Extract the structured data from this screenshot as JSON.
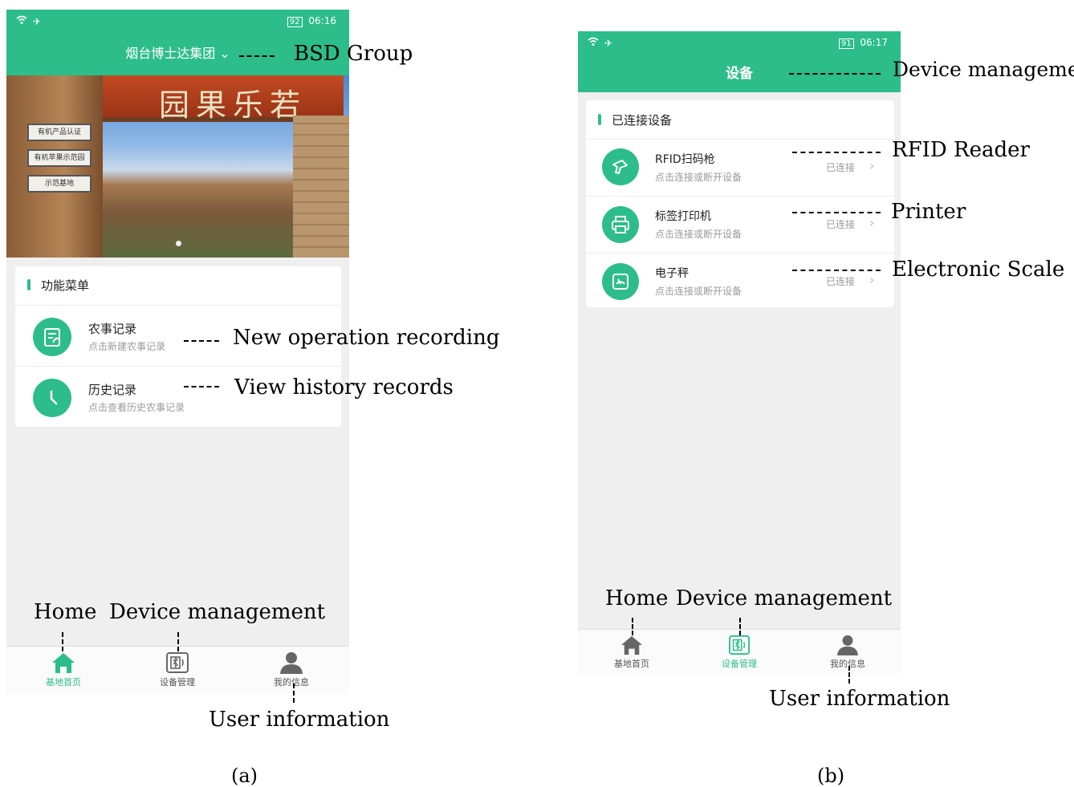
{
  "panel_a": {
    "status_time": "06:16",
    "battery": "92",
    "header_title": "烟台博士达集团",
    "section_title": "功能菜单",
    "items": [
      {
        "title": "农事记录",
        "subtitle": "点击新建农事记录"
      },
      {
        "title": "历史记录",
        "subtitle": "点击查看历史农事记录"
      }
    ],
    "tabs": [
      "基地首页",
      "设备管理",
      "我的信息"
    ]
  },
  "panel_b": {
    "status_time": "06:17",
    "battery": "91",
    "header_title": "设备",
    "section_title": "已连接设备",
    "devices": [
      {
        "title": "RFID扫码枪",
        "subtitle": "点击连接或断开设备",
        "status": "已连接"
      },
      {
        "title": "标签打印机",
        "subtitle": "点击连接或断开设备",
        "status": "已连接"
      },
      {
        "title": "电子秤",
        "subtitle": "点击连接或断开设备",
        "status": "已连接"
      }
    ],
    "tabs": [
      "基地首页",
      "设备管理",
      "我的信息"
    ]
  },
  "annotations": {
    "bsd_group": "BSD Group",
    "new_operation": "New operation recording",
    "view_history": "View history records",
    "home_a": "Home",
    "device_mgmt_a": "Device management",
    "user_info_a": "User information",
    "device_mgmt_header": "Device management",
    "rfid": "RFID Reader",
    "printer": "Printer",
    "scale": "Electronic Scale",
    "home_b": "Home",
    "device_mgmt_b": "Device management",
    "user_info_b": "User information"
  },
  "captions": {
    "a": "(a)",
    "b": "(b)"
  },
  "colors": {
    "brand_green": "#2dbd8a",
    "muted_text": "#9a9a9a"
  },
  "icons": [
    "wifi-icon",
    "airplane-icon",
    "bluetooth-icon",
    "notebook-icon",
    "clock-icon",
    "scanner-icon",
    "printer-icon",
    "scale-icon",
    "home-icon",
    "device-icon",
    "user-icon",
    "chevron-right-icon"
  ]
}
